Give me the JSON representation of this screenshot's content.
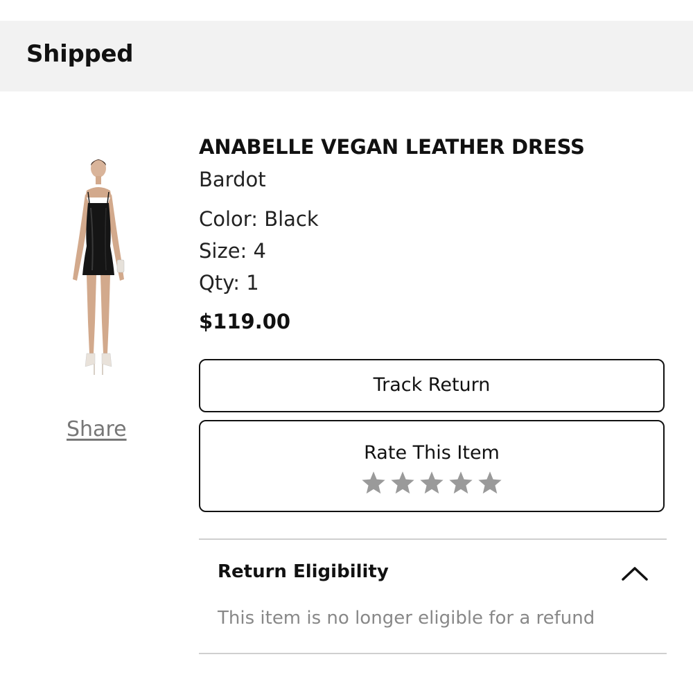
{
  "header": {
    "status": "Shipped"
  },
  "product": {
    "name": "ANABELLE VEGAN LEATHER DRESS",
    "brand": "Bardot",
    "color": "Color: Black",
    "size": "Size: 4",
    "qty": "Qty: 1",
    "price": "$119.00",
    "image_icon": "dress-photo"
  },
  "actions": {
    "share_label": "Share",
    "track_return_label": "Track Return",
    "rate_label": "Rate This Item",
    "star_count": 5,
    "star_color": "#9a9a9a"
  },
  "eligibility": {
    "title": "Return Eligibility",
    "message": "This item is no longer eligible for a refund",
    "expanded_icon": "chevron-up-icon"
  }
}
